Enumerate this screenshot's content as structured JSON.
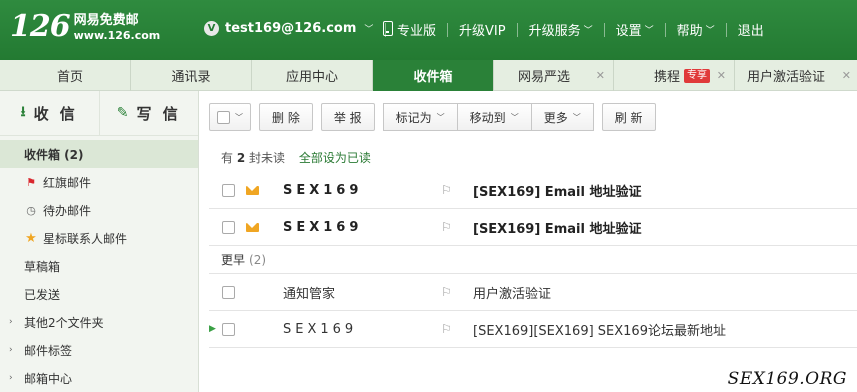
{
  "header": {
    "logo_number": "126",
    "logo_cn": "网易免费邮",
    "logo_url": "www.126.com",
    "account_badge": "V",
    "account_email": "test169@126.com",
    "nav": [
      {
        "label": "专业版",
        "has_dropdown": false
      },
      {
        "label": "升级VIP",
        "has_dropdown": false
      },
      {
        "label": "升级服务",
        "has_dropdown": true
      },
      {
        "label": "设置",
        "has_dropdown": true
      },
      {
        "label": "帮助",
        "has_dropdown": true
      },
      {
        "label": "退出",
        "has_dropdown": false
      }
    ],
    "colors": {
      "brand_green": "#237a32",
      "active_tab": "#2a8138",
      "hot_badge": "#e03a3a"
    }
  },
  "tabs": [
    {
      "label": "首页",
      "active": false,
      "closable": false
    },
    {
      "label": "通讯录",
      "active": false,
      "closable": false
    },
    {
      "label": "应用中心",
      "active": false,
      "closable": false
    },
    {
      "label": "收件箱",
      "active": true,
      "closable": false
    },
    {
      "label": "网易严选",
      "active": false,
      "closable": true
    },
    {
      "label": "携程",
      "badge": "专享",
      "active": false,
      "closable": true
    },
    {
      "label": "用户激活验证",
      "active": false,
      "closable": true
    }
  ],
  "sidebar": {
    "receive_label": "收 信",
    "compose_label": "写 信",
    "folders": [
      {
        "label": "收件箱 (2)",
        "icon": "",
        "active": true
      },
      {
        "label": "红旗邮件",
        "icon": "red-flag-icon"
      },
      {
        "label": "待办邮件",
        "icon": "clock-icon"
      },
      {
        "label": "星标联系人邮件",
        "icon": "star-icon"
      },
      {
        "label": "草稿箱",
        "icon": ""
      },
      {
        "label": "已发送",
        "icon": ""
      },
      {
        "label": "其他2个文件夹",
        "icon": "",
        "expandable": true
      },
      {
        "label": "邮件标签",
        "icon": "",
        "expandable": true
      },
      {
        "label": "邮箱中心",
        "icon": "",
        "expandable": true
      }
    ]
  },
  "toolbar": {
    "delete": "删 除",
    "report": "举 报",
    "mark_as": "标记为",
    "move_to": "移动到",
    "more": "更多",
    "refresh": "刷 新"
  },
  "summary": {
    "prefix": "有",
    "count": "2",
    "suffix": "封未读",
    "mark_all_read": "全部设为已读"
  },
  "mails_unread": [
    {
      "sender": "SEX169",
      "subject": "[SEX169] Email 地址验证"
    },
    {
      "sender": "SEX169",
      "subject": "[SEX169] Email 地址验证"
    }
  ],
  "group": {
    "label": "更早",
    "count": "(2)"
  },
  "mails_earlier": [
    {
      "sender": "通知管家",
      "subject": "用户激活验证"
    },
    {
      "sender": "SEX169",
      "subject": "[SEX169][SEX169] SEX169论坛最新地址"
    }
  ],
  "watermark": "SEX169.ORG"
}
